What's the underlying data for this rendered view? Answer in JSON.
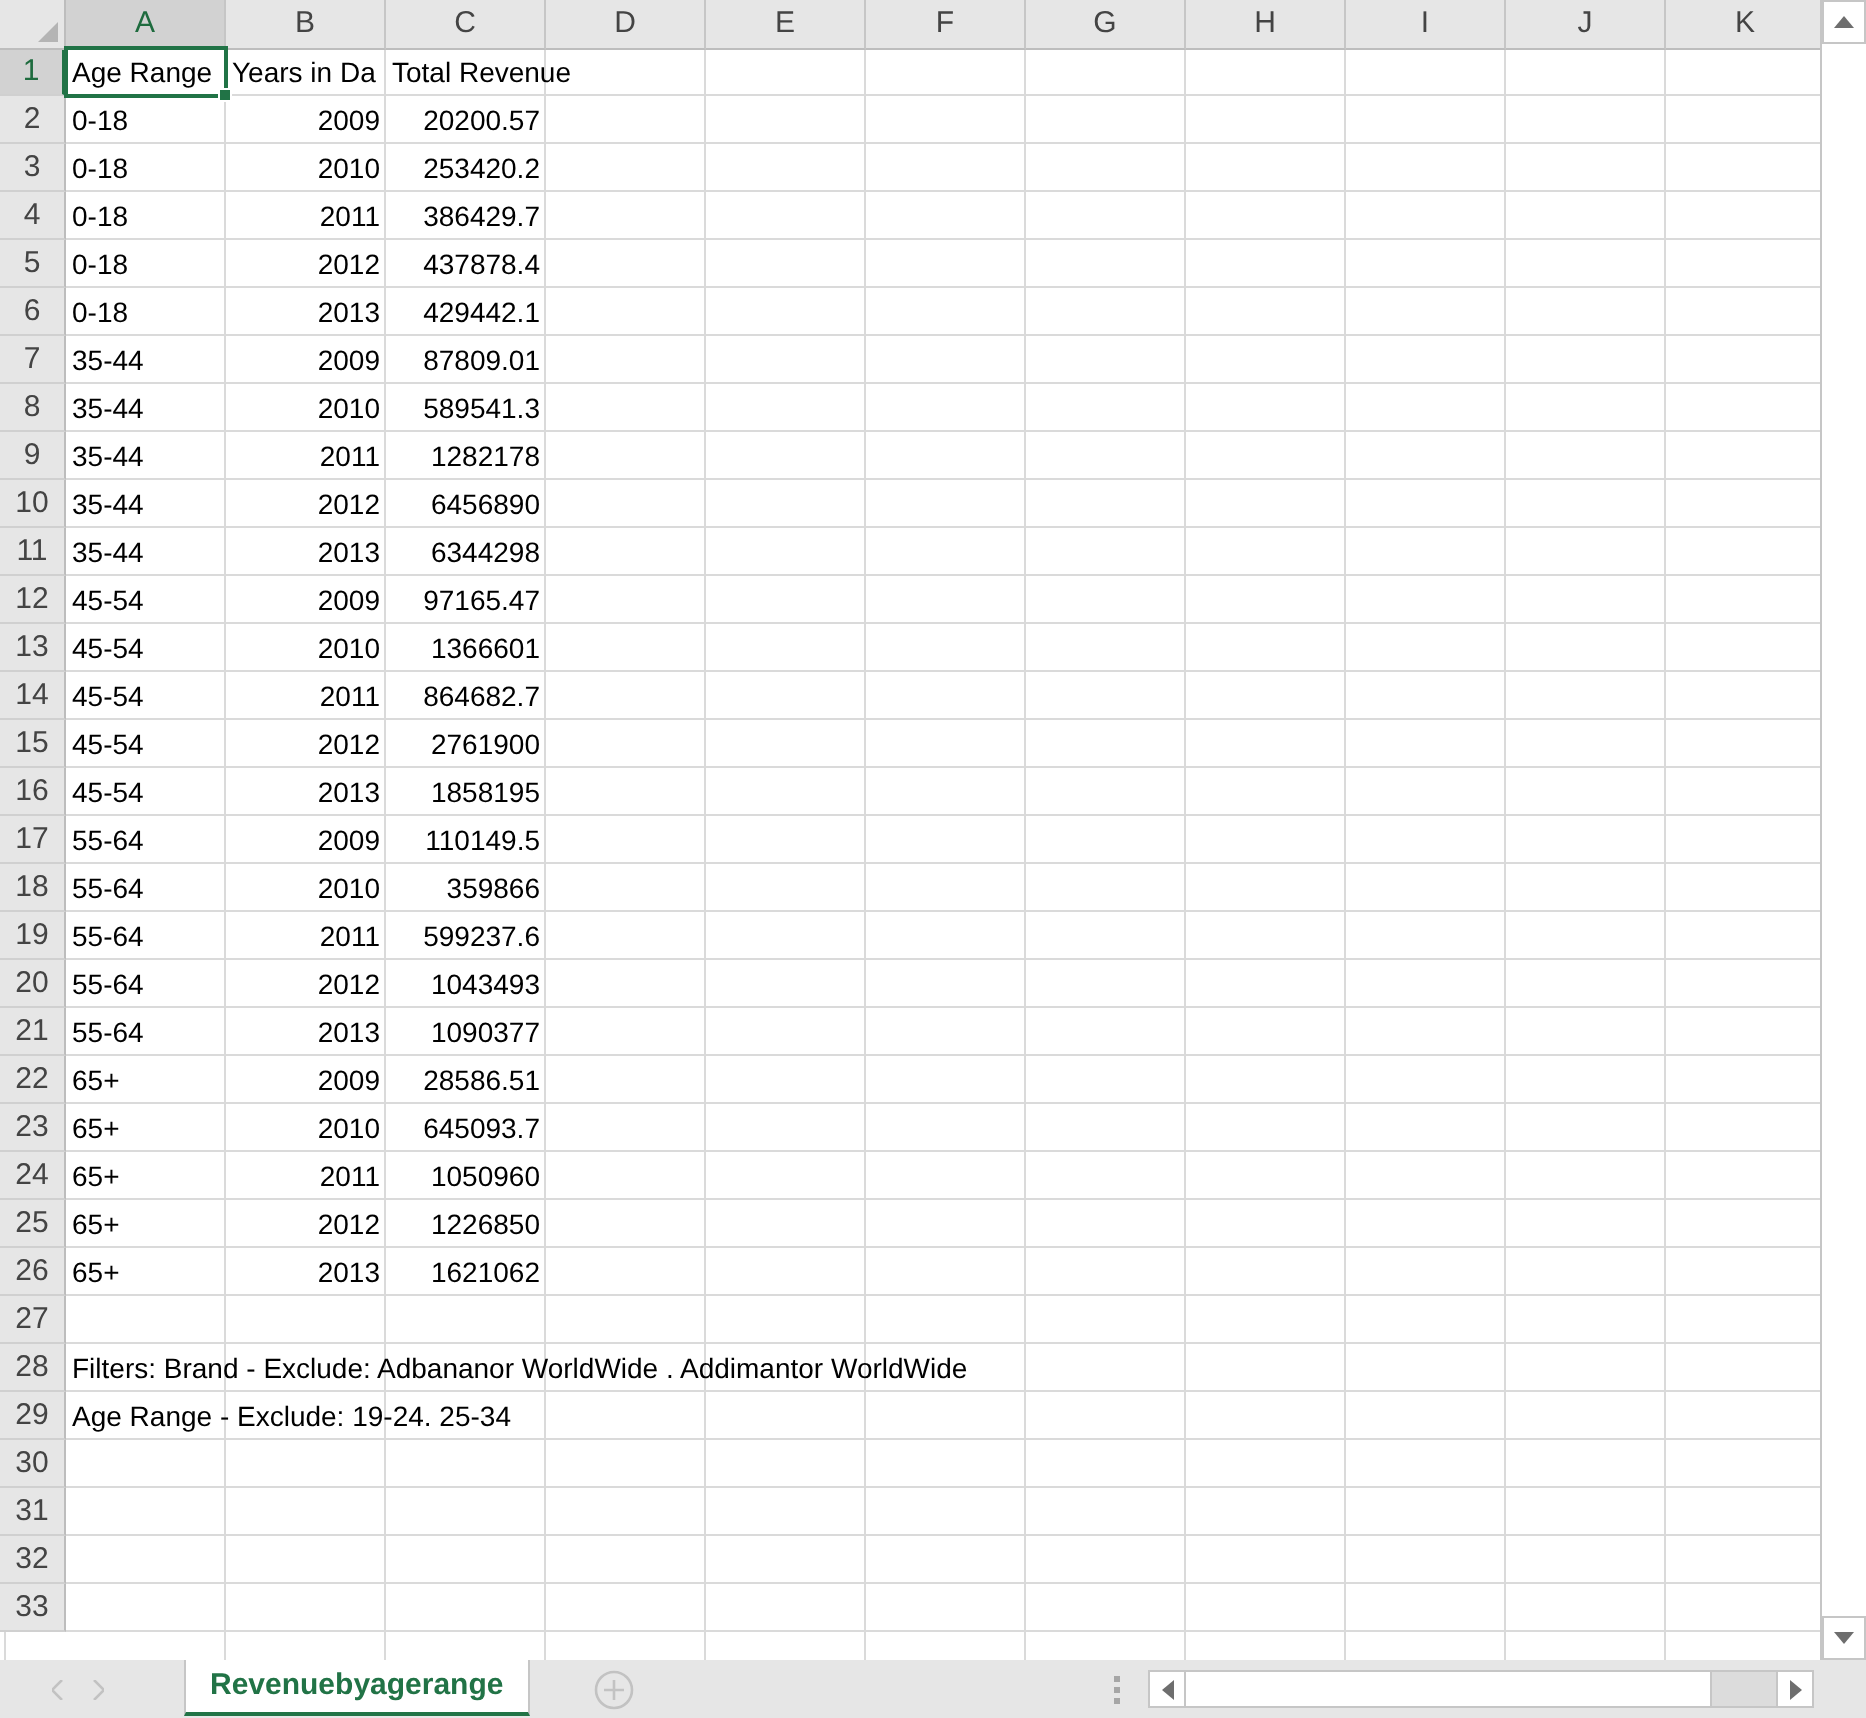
{
  "columns": [
    {
      "label": "A",
      "selected": true
    },
    {
      "label": "B",
      "selected": false
    },
    {
      "label": "C",
      "selected": false
    },
    {
      "label": "D",
      "selected": false
    },
    {
      "label": "E",
      "selected": false
    },
    {
      "label": "F",
      "selected": false
    },
    {
      "label": "G",
      "selected": false
    },
    {
      "label": "H",
      "selected": false
    },
    {
      "label": "I",
      "selected": false
    },
    {
      "label": "J",
      "selected": false
    },
    {
      "label": "K",
      "selected": false
    }
  ],
  "rows": [
    {
      "number": "1",
      "selected": true,
      "cells": [
        {
          "text": "Age Range",
          "kind": "text",
          "selected": true
        },
        {
          "text": "Years in Da",
          "kind": "text",
          "selected": false
        },
        {
          "text": "Total Revenue",
          "kind": "text",
          "selected": false
        }
      ]
    },
    {
      "number": "2",
      "selected": false,
      "cells": [
        {
          "text": "0-18",
          "kind": "text",
          "selected": false
        },
        {
          "text": "2009",
          "kind": "number",
          "selected": false
        },
        {
          "text": "20200.57",
          "kind": "number",
          "selected": false
        }
      ]
    },
    {
      "number": "3",
      "selected": false,
      "cells": [
        {
          "text": "0-18",
          "kind": "text",
          "selected": false
        },
        {
          "text": "2010",
          "kind": "number",
          "selected": false
        },
        {
          "text": "253420.2",
          "kind": "number",
          "selected": false
        }
      ]
    },
    {
      "number": "4",
      "selected": false,
      "cells": [
        {
          "text": "0-18",
          "kind": "text",
          "selected": false
        },
        {
          "text": "2011",
          "kind": "number",
          "selected": false
        },
        {
          "text": "386429.7",
          "kind": "number",
          "selected": false
        }
      ]
    },
    {
      "number": "5",
      "selected": false,
      "cells": [
        {
          "text": "0-18",
          "kind": "text",
          "selected": false
        },
        {
          "text": "2012",
          "kind": "number",
          "selected": false
        },
        {
          "text": "437878.4",
          "kind": "number",
          "selected": false
        }
      ]
    },
    {
      "number": "6",
      "selected": false,
      "cells": [
        {
          "text": "0-18",
          "kind": "text",
          "selected": false
        },
        {
          "text": "2013",
          "kind": "number",
          "selected": false
        },
        {
          "text": "429442.1",
          "kind": "number",
          "selected": false
        }
      ]
    },
    {
      "number": "7",
      "selected": false,
      "cells": [
        {
          "text": "35-44",
          "kind": "text",
          "selected": false
        },
        {
          "text": "2009",
          "kind": "number",
          "selected": false
        },
        {
          "text": "87809.01",
          "kind": "number",
          "selected": false
        }
      ]
    },
    {
      "number": "8",
      "selected": false,
      "cells": [
        {
          "text": "35-44",
          "kind": "text",
          "selected": false
        },
        {
          "text": "2010",
          "kind": "number",
          "selected": false
        },
        {
          "text": "589541.3",
          "kind": "number",
          "selected": false
        }
      ]
    },
    {
      "number": "9",
      "selected": false,
      "cells": [
        {
          "text": "35-44",
          "kind": "text",
          "selected": false
        },
        {
          "text": "2011",
          "kind": "number",
          "selected": false
        },
        {
          "text": "1282178",
          "kind": "number",
          "selected": false
        }
      ]
    },
    {
      "number": "10",
      "selected": false,
      "cells": [
        {
          "text": "35-44",
          "kind": "text",
          "selected": false
        },
        {
          "text": "2012",
          "kind": "number",
          "selected": false
        },
        {
          "text": "6456890",
          "kind": "number",
          "selected": false
        }
      ]
    },
    {
      "number": "11",
      "selected": false,
      "cells": [
        {
          "text": "35-44",
          "kind": "text",
          "selected": false
        },
        {
          "text": "2013",
          "kind": "number",
          "selected": false
        },
        {
          "text": "6344298",
          "kind": "number",
          "selected": false
        }
      ]
    },
    {
      "number": "12",
      "selected": false,
      "cells": [
        {
          "text": "45-54",
          "kind": "text",
          "selected": false
        },
        {
          "text": "2009",
          "kind": "number",
          "selected": false
        },
        {
          "text": "97165.47",
          "kind": "number",
          "selected": false
        }
      ]
    },
    {
      "number": "13",
      "selected": false,
      "cells": [
        {
          "text": "45-54",
          "kind": "text",
          "selected": false
        },
        {
          "text": "2010",
          "kind": "number",
          "selected": false
        },
        {
          "text": "1366601",
          "kind": "number",
          "selected": false
        }
      ]
    },
    {
      "number": "14",
      "selected": false,
      "cells": [
        {
          "text": "45-54",
          "kind": "text",
          "selected": false
        },
        {
          "text": "2011",
          "kind": "number",
          "selected": false
        },
        {
          "text": "864682.7",
          "kind": "number",
          "selected": false
        }
      ]
    },
    {
      "number": "15",
      "selected": false,
      "cells": [
        {
          "text": "45-54",
          "kind": "text",
          "selected": false
        },
        {
          "text": "2012",
          "kind": "number",
          "selected": false
        },
        {
          "text": "2761900",
          "kind": "number",
          "selected": false
        }
      ]
    },
    {
      "number": "16",
      "selected": false,
      "cells": [
        {
          "text": "45-54",
          "kind": "text",
          "selected": false
        },
        {
          "text": "2013",
          "kind": "number",
          "selected": false
        },
        {
          "text": "1858195",
          "kind": "number",
          "selected": false
        }
      ]
    },
    {
      "number": "17",
      "selected": false,
      "cells": [
        {
          "text": "55-64",
          "kind": "text",
          "selected": false
        },
        {
          "text": "2009",
          "kind": "number",
          "selected": false
        },
        {
          "text": "110149.5",
          "kind": "number",
          "selected": false
        }
      ]
    },
    {
      "number": "18",
      "selected": false,
      "cells": [
        {
          "text": "55-64",
          "kind": "text",
          "selected": false
        },
        {
          "text": "2010",
          "kind": "number",
          "selected": false
        },
        {
          "text": "359866",
          "kind": "number",
          "selected": false
        }
      ]
    },
    {
      "number": "19",
      "selected": false,
      "cells": [
        {
          "text": "55-64",
          "kind": "text",
          "selected": false
        },
        {
          "text": "2011",
          "kind": "number",
          "selected": false
        },
        {
          "text": "599237.6",
          "kind": "number",
          "selected": false
        }
      ]
    },
    {
      "number": "20",
      "selected": false,
      "cells": [
        {
          "text": "55-64",
          "kind": "text",
          "selected": false
        },
        {
          "text": "2012",
          "kind": "number",
          "selected": false
        },
        {
          "text": "1043493",
          "kind": "number",
          "selected": false
        }
      ]
    },
    {
      "number": "21",
      "selected": false,
      "cells": [
        {
          "text": "55-64",
          "kind": "text",
          "selected": false
        },
        {
          "text": "2013",
          "kind": "number",
          "selected": false
        },
        {
          "text": "1090377",
          "kind": "number",
          "selected": false
        }
      ]
    },
    {
      "number": "22",
      "selected": false,
      "cells": [
        {
          "text": "65+",
          "kind": "text",
          "selected": false
        },
        {
          "text": "2009",
          "kind": "number",
          "selected": false
        },
        {
          "text": "28586.51",
          "kind": "number",
          "selected": false
        }
      ]
    },
    {
      "number": "23",
      "selected": false,
      "cells": [
        {
          "text": "65+",
          "kind": "text",
          "selected": false
        },
        {
          "text": "2010",
          "kind": "number",
          "selected": false
        },
        {
          "text": "645093.7",
          "kind": "number",
          "selected": false
        }
      ]
    },
    {
      "number": "24",
      "selected": false,
      "cells": [
        {
          "text": "65+",
          "kind": "text",
          "selected": false
        },
        {
          "text": "2011",
          "kind": "number",
          "selected": false
        },
        {
          "text": "1050960",
          "kind": "number",
          "selected": false
        }
      ]
    },
    {
      "number": "25",
      "selected": false,
      "cells": [
        {
          "text": "65+",
          "kind": "text",
          "selected": false
        },
        {
          "text": "2012",
          "kind": "number",
          "selected": false
        },
        {
          "text": "1226850",
          "kind": "number",
          "selected": false
        }
      ]
    },
    {
      "number": "26",
      "selected": false,
      "cells": [
        {
          "text": "65+",
          "kind": "text",
          "selected": false
        },
        {
          "text": "2013",
          "kind": "number",
          "selected": false
        },
        {
          "text": "1621062",
          "kind": "number",
          "selected": false
        }
      ]
    },
    {
      "number": "27",
      "selected": false,
      "cells": []
    },
    {
      "number": "28",
      "selected": false,
      "cells": [
        {
          "text": "Filters: Brand - Exclude: Adbananor WorldWide . Addimantor WorldWide",
          "kind": "text",
          "selected": false
        }
      ]
    },
    {
      "number": "29",
      "selected": false,
      "cells": [
        {
          "text": "Age Range - Exclude: 19-24. 25-34",
          "kind": "text",
          "selected": false
        }
      ]
    },
    {
      "number": "30",
      "selected": false,
      "cells": []
    },
    {
      "number": "31",
      "selected": false,
      "cells": []
    },
    {
      "number": "32",
      "selected": false,
      "cells": []
    },
    {
      "number": "33",
      "selected": false,
      "cells": []
    }
  ],
  "sheets": [
    {
      "label": "Revenuebyagerange",
      "selected": true
    }
  ]
}
